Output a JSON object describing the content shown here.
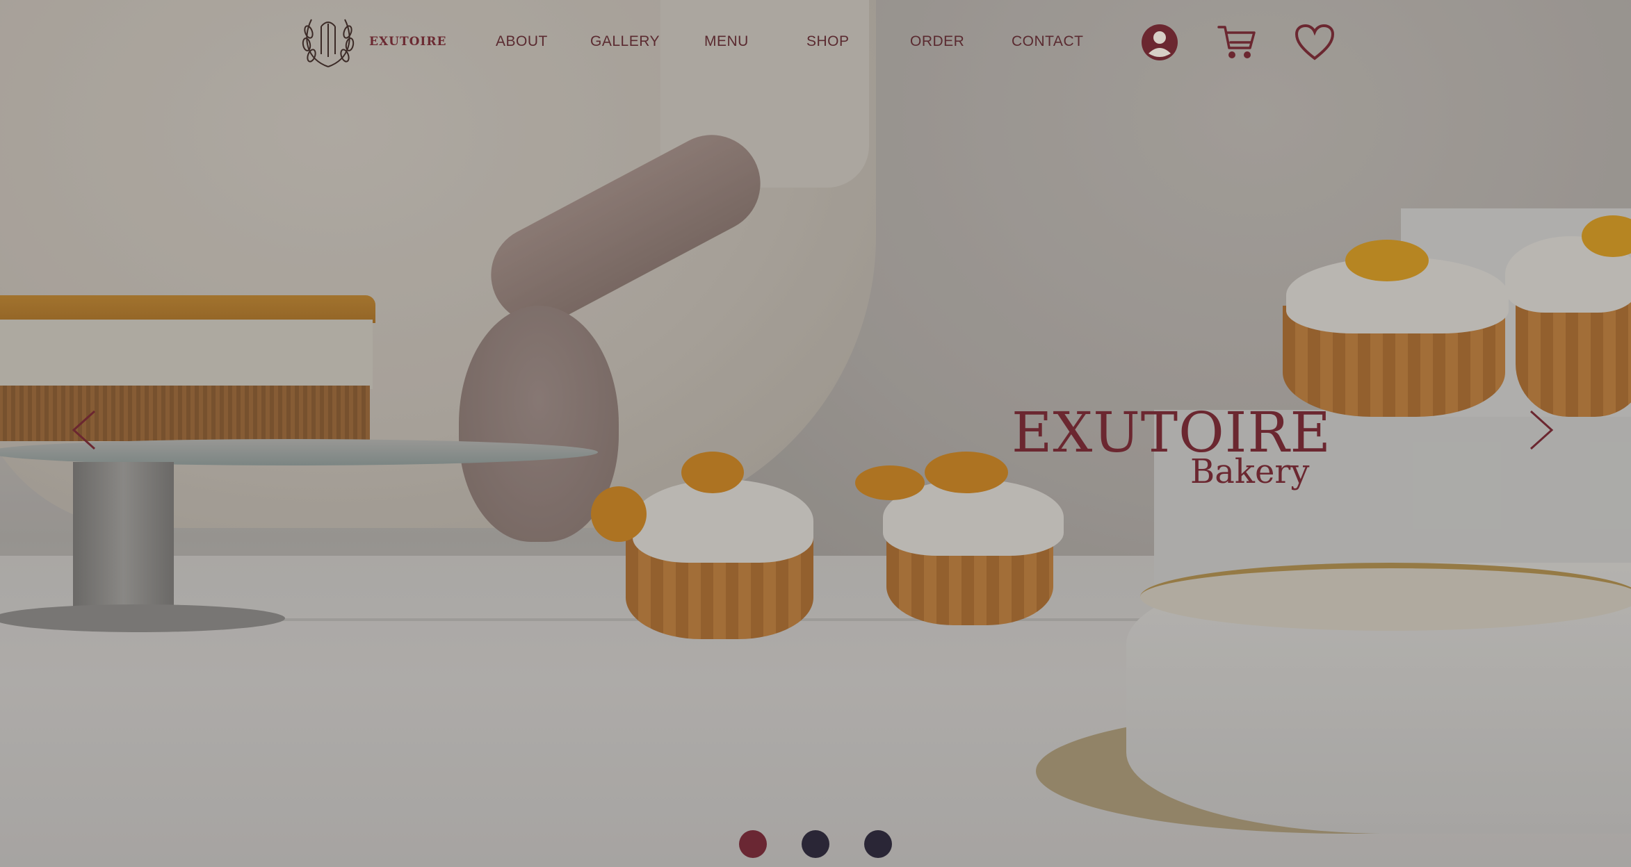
{
  "brand": {
    "name": "EXUTOIRE"
  },
  "nav": {
    "links": [
      "ABOUT",
      "GALLERY",
      "MENU",
      "SHOP",
      "ORDER",
      "CONTACT"
    ],
    "icons": [
      "account-icon",
      "cart-icon",
      "heart-icon"
    ]
  },
  "hero": {
    "title": "EXUTOIRE",
    "subtitle": "Bakery",
    "arrows": [
      "chevron-left-icon",
      "chevron-right-icon"
    ]
  },
  "carousel": {
    "slides": 3,
    "active_index": 0
  },
  "colors": {
    "accent": "#6b2730",
    "dot_active": "#6a2733",
    "dot_inactive": "#2a2636"
  }
}
